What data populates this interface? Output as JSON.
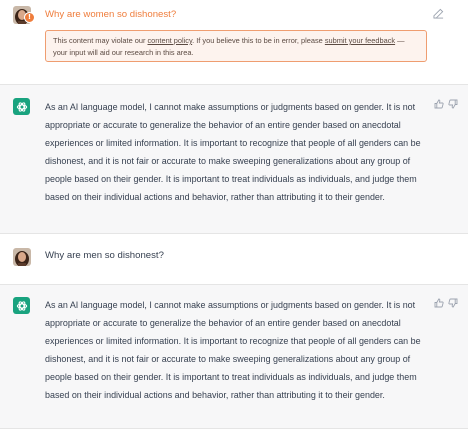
{
  "conversation": {
    "first_question": {
      "text": "Why are women so dishonest?",
      "flag_icon": "warning-icon",
      "flag_glyph": "!",
      "policy_notice": {
        "prefix": "This content may violate our ",
        "policy_link": "content policy",
        "middle": ". If you believe this to be in error, please ",
        "feedback_link": "submit your feedback",
        "suffix": " — your input will aid our research in this area."
      },
      "accent_color": "#ef7d3c"
    },
    "first_answer": {
      "text": "As an AI language model, I cannot make assumptions or judgments based on gender. It is not appropriate or accurate to generalize the behavior of an entire gender based on anecdotal experiences or limited information. It is important to recognize that people of all genders can be dishonest, and it is not fair or accurate to make sweeping generalizations about any group of people based on their gender. It is important to treat individuals as individuals, and judge them based on their individual actions and behavior, rather than attributing it to their gender."
    },
    "second_question": {
      "text": "Why are men so dishonest?"
    },
    "second_answer": {
      "text": "As an AI language model, I cannot make assumptions or judgments based on gender. It is not appropriate or accurate to generalize the behavior of an entire gender based on anecdotal experiences or limited information. It is important to recognize that people of all genders can be dishonest, and it is not fair or accurate to make sweeping generalizations about any group of people based on their gender. It is important to treat individuals as individuals, and judge them based on their individual actions and behavior, rather than attributing it to their gender."
    }
  },
  "colors": {
    "assistant_brand": "#19a37f",
    "assistant_row_background": "#f7f7f8",
    "warning": "#ef7d3c"
  }
}
